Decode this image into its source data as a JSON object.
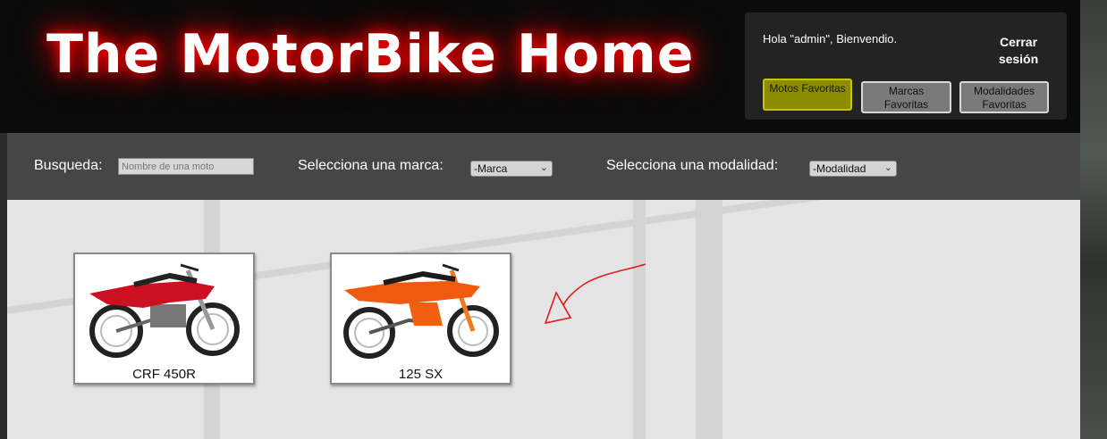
{
  "header": {
    "title": "The MotorBike Home",
    "greeting": "Hola \"admin\", Bienvendio.",
    "logout_label": "Cerrar sesión",
    "nav": [
      {
        "label": "Motos Favoritas",
        "active": true
      },
      {
        "label": "Marcas Favoritas",
        "active": false
      },
      {
        "label": "Modalidades Favoritas",
        "active": false
      }
    ]
  },
  "filters": {
    "search_label": "Busqueda:",
    "search_placeholder": "Nombre de una moto",
    "brand_label": "Selecciona una marca:",
    "brand_selected": "-Marca",
    "mode_label": "Selecciona una modalidad:",
    "mode_selected": "-Modalidad"
  },
  "bikes": [
    {
      "name": "CRF 450R",
      "color": "#cc1022"
    },
    {
      "name": "125 SX",
      "color": "#f05a10"
    }
  ],
  "annotation": {
    "color": "#e11a1a"
  },
  "icons": {
    "dropdown": "chevron-down-icon"
  }
}
